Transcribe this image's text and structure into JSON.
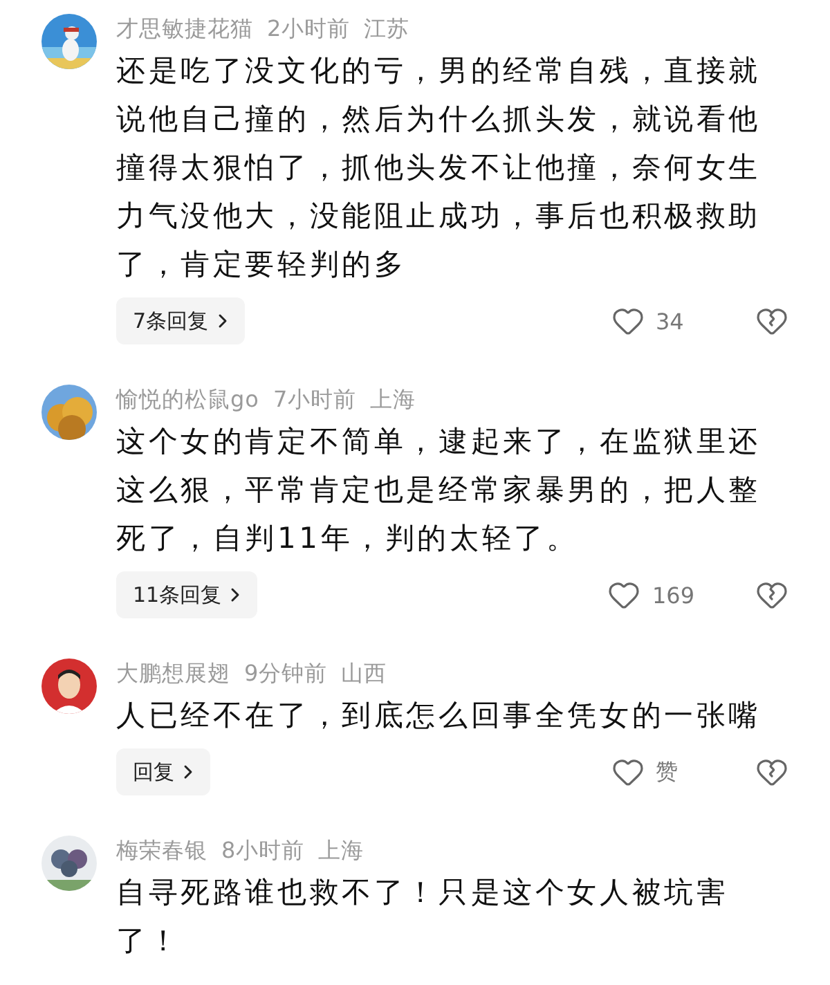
{
  "comments": [
    {
      "author": "才思敏捷花猫",
      "time": "2小时前",
      "location": "江苏",
      "text": "还是吃了没文化的亏，男的经常自残，直接就说他自己撞的，然后为什么抓头发，就说看他撞得太狠怕了，抓他头发不让他撞，奈何女生力气没他大，没能阻止成功，事后也积极救助了，肯定要轻判的多",
      "replies": "7条回复",
      "likes": "34"
    },
    {
      "author": "愉悦的松鼠go",
      "time": "7小时前",
      "location": "上海",
      "text": "这个女的肯定不简单，逮起来了，在监狱里还这么狠，平常肯定也是经常家暴男的，把人整死了，自判11年，判的太轻了。",
      "replies": "11条回复",
      "likes": "169"
    },
    {
      "author": "大鹏想展翅",
      "time": "9分钟前",
      "location": "山西",
      "text": "人已经不在了，到底怎么回事全凭女的一张嘴",
      "replies": "回复",
      "likes": "赞"
    },
    {
      "author": "梅荣春银",
      "time": "8小时前",
      "location": "上海",
      "text": "自寻死路谁也救不了！只是这个女人被坑害了！"
    }
  ]
}
